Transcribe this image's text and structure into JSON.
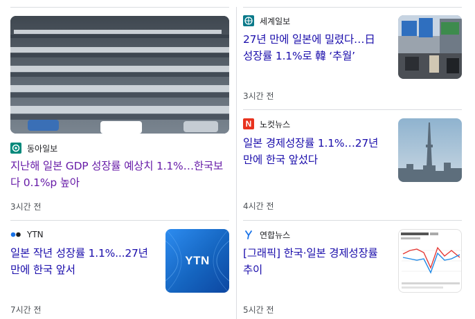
{
  "articles": [
    {
      "source": "동아일보",
      "headline": "지난해 일본 GDP 성장률 예상치 1.1%…한국보다 0.1%p 높아",
      "time": "3시간 전",
      "thumbnail": "parking-lot-cars-photo"
    },
    {
      "source": "세계일보",
      "headline": "27년 만에 일본에 밀렸다…日 성장률 1.1%로 韓 ‘추월’",
      "time": "3시간 전",
      "thumbnail": "street-traffic-signs-photo"
    },
    {
      "source": "노컷뉴스",
      "headline": "일본 경제성장률 1.1%…27년 만에 한국 앞섰다",
      "time": "4시간 전",
      "thumbnail": "tokyo-skytree-city-photo"
    },
    {
      "source": "YTN",
      "headline": "일본 작년 성장률 1.1%...27년 만에 한국 앞서",
      "time": "7시간 전",
      "thumbnail": "ytn-logo-tile",
      "thumbnail_text": "YTN"
    },
    {
      "source": "연합뉴스",
      "headline": "[그래픽] 한국·일본 경제성장률 추이",
      "time": "5시간 전",
      "thumbnail": "growth-rate-line-chart-graphic"
    }
  ],
  "colors": {
    "headline_link": "#1a0dab",
    "headline_visited": "#681da8",
    "ytn_blue": "#1a73e8",
    "nocut_red": "#e8331f"
  }
}
